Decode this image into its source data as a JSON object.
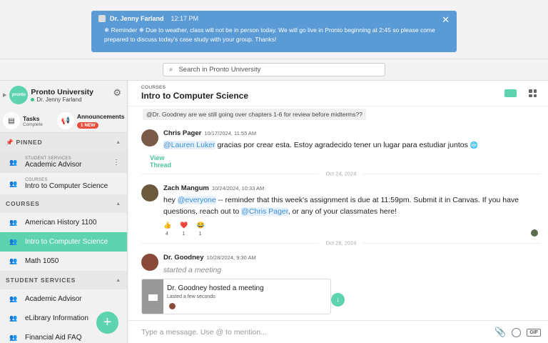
{
  "notification": {
    "sender": "Dr. Jenny Farland",
    "time": "12:17 PM",
    "message": "❄ Reminder ❄ Due to weather, class will not be in person today. We will go live in Pronto beginning at 2:45 so please come prepared to discuss today's case study with your group. Thanks!"
  },
  "search": {
    "placeholder": "Search in Pronto University"
  },
  "org": {
    "name": "Pronto University",
    "logo_text": "pronto",
    "user": "Dr. Jenny Farland"
  },
  "quick": {
    "tasks_label": "Tasks",
    "tasks_status": "Complete",
    "announcements_label": "Announcements",
    "announcements_badge": "1 NEW"
  },
  "sidebar": {
    "pinned_header": "PINNED",
    "pinned": [
      {
        "sub": "STUDENT SERVICES",
        "label": "Academic Advisor"
      },
      {
        "sub": "COURSES",
        "label": "Intro to Computer Science"
      }
    ],
    "courses_header": "COURSES",
    "courses": [
      {
        "label": "American History 1100"
      },
      {
        "label": "Intro to Computer Science"
      },
      {
        "label": "Math 1050"
      }
    ],
    "services_header": "STUDENT SERVICES",
    "services": [
      {
        "label": "Academic Advisor"
      },
      {
        "label": "eLibrary Information"
      },
      {
        "label": "Financial Aid FAQ"
      }
    ]
  },
  "channel": {
    "crumb": "COURSES",
    "title": "Intro to Computer Science"
  },
  "messages": {
    "quoted": "@Dr. Goodney are we still going over chapters 1-6 for review before midterms??",
    "m1": {
      "name": "Chris Pager",
      "time": "10/17/2024, 11:55 AM",
      "mention": "@Lauren Luker",
      "text": " gracias por crear esta. Estoy agradecido tener un lugar para estudiar juntos",
      "view_thread": "View Thread"
    },
    "date1": "Oct 24, 2024",
    "m2": {
      "name": "Zach Mangum",
      "time": "10/24/2024, 10:33 AM",
      "t1": "hey ",
      "mention1": "@everyone",
      "t2": " -- reminder that this week's assignment is due at 11:59pm. Submit it in Canvas. If you have questions, reach out to ",
      "mention2": "@Chris Pager",
      "t3": ", or any of your classmates here!",
      "reactions": [
        {
          "emoji": "👍",
          "count": "4"
        },
        {
          "emoji": "❤️",
          "count": "1"
        },
        {
          "emoji": "😂",
          "count": "1"
        }
      ]
    },
    "date2": "Oct 28, 2024",
    "m3": {
      "name": "Dr. Goodney",
      "time": "10/28/2024, 9:30 AM",
      "action": "started a meeting",
      "meeting_title": "Dr. Goodney hosted a meeting",
      "meeting_sub": "Lasted a few seconds"
    }
  },
  "composer": {
    "placeholder": "Type a message. Use @ to mention...",
    "gif": "GIF"
  }
}
